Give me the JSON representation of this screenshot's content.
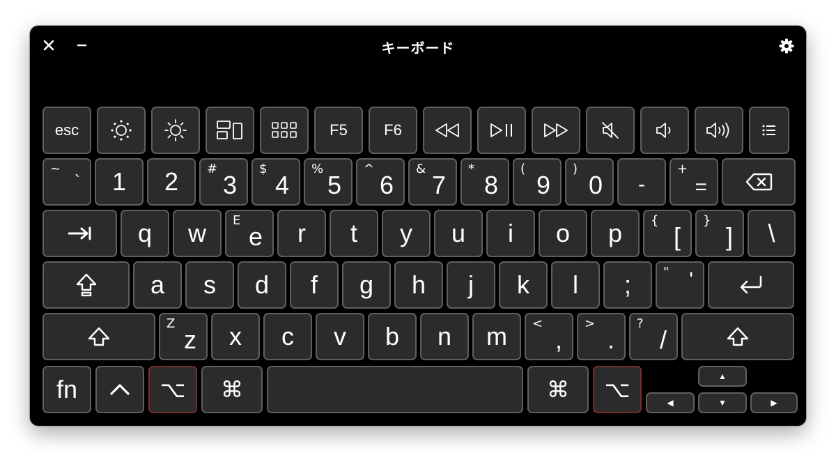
{
  "window": {
    "title": "キーボード"
  },
  "function_row": {
    "esc": "esc",
    "f5": "F5",
    "f6": "F6"
  },
  "number_row": [
    {
      "top": "~",
      "main": "`"
    },
    {
      "main": "1"
    },
    {
      "main": "2"
    },
    {
      "top": "#",
      "main": "3"
    },
    {
      "top": "$",
      "main": "4"
    },
    {
      "top": "%",
      "main": "5"
    },
    {
      "top": "^",
      "main": "6"
    },
    {
      "top": "&",
      "main": "7"
    },
    {
      "top": "*",
      "main": "8"
    },
    {
      "top": "(",
      "main": "9"
    },
    {
      "top": ")",
      "main": "0"
    },
    {
      "main": "-"
    },
    {
      "top": "+",
      "main": "="
    }
  ],
  "q_row": [
    {
      "main": "q"
    },
    {
      "main": "w"
    },
    {
      "top": "E",
      "main": "e"
    },
    {
      "main": "r"
    },
    {
      "main": "t"
    },
    {
      "main": "y"
    },
    {
      "main": "u"
    },
    {
      "main": "i"
    },
    {
      "main": "o"
    },
    {
      "main": "p"
    },
    {
      "top": "{",
      "main": "["
    },
    {
      "top": "}",
      "main": "]"
    },
    {
      "main": "\\"
    }
  ],
  "a_row": [
    {
      "main": "a"
    },
    {
      "main": "s"
    },
    {
      "main": "d"
    },
    {
      "main": "f"
    },
    {
      "main": "g"
    },
    {
      "main": "h"
    },
    {
      "main": "j"
    },
    {
      "main": "k"
    },
    {
      "main": "l"
    },
    {
      "main": ";"
    },
    {
      "top": "\"",
      "main": "'"
    }
  ],
  "z_row": [
    {
      "top": "Z",
      "main": "z"
    },
    {
      "main": "x"
    },
    {
      "main": "c"
    },
    {
      "main": "v"
    },
    {
      "main": "b"
    },
    {
      "main": "n"
    },
    {
      "main": "m"
    },
    {
      "top": "<",
      "main": ","
    },
    {
      "top": ">",
      "main": "."
    },
    {
      "top": "?",
      "main": "/"
    }
  ],
  "bottom_row": {
    "fn": "fn",
    "control": "^",
    "option": "⌥",
    "command": "⌘",
    "arrow_up": "▲",
    "arrow_left": "◀",
    "arrow_down": "▼",
    "arrow_right": "▶"
  },
  "colors": {
    "window_bg": "#000000",
    "key_bg": "#2b2b2b",
    "key_border": "#5f5f5f",
    "highlight_border": "#7a2c2c",
    "text": "#ffffff"
  }
}
